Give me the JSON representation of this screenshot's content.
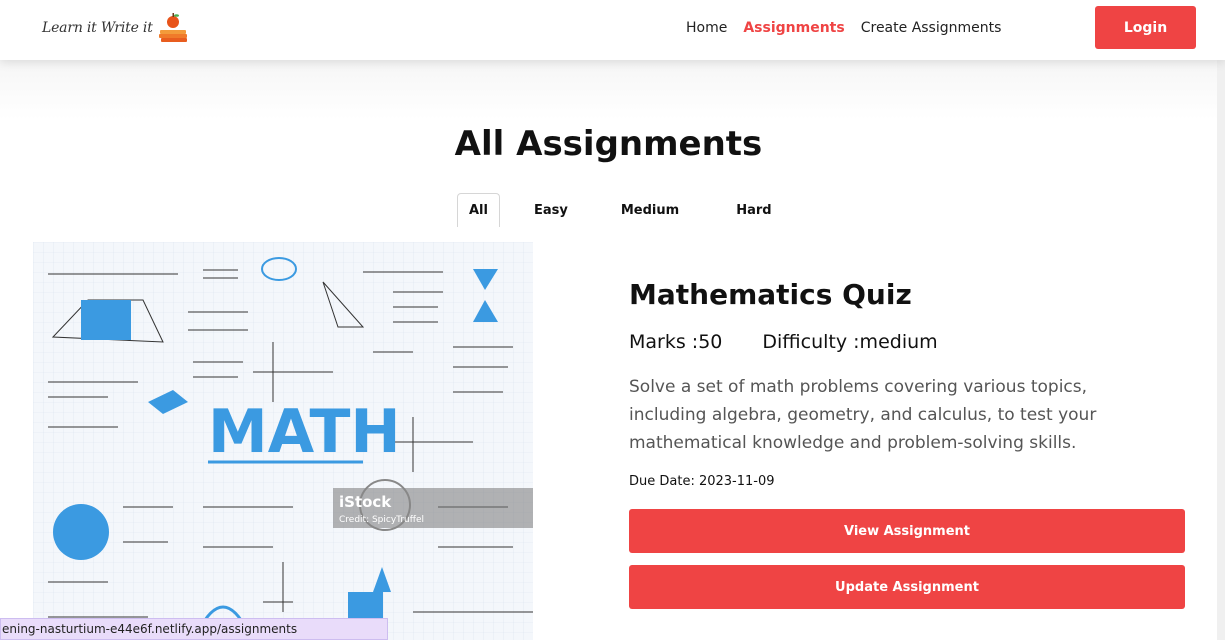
{
  "header": {
    "logo_text": "Learn it Write it",
    "nav": [
      {
        "label": "Home",
        "active": false
      },
      {
        "label": "Assignments",
        "active": true
      },
      {
        "label": "Create Assignments",
        "active": false
      }
    ],
    "login_label": "Login"
  },
  "page": {
    "title": "All Assignments",
    "tabs": [
      {
        "label": "All",
        "active": true
      },
      {
        "label": "Easy",
        "active": false
      },
      {
        "label": "Medium",
        "active": false
      },
      {
        "label": "Hard",
        "active": false
      }
    ]
  },
  "card": {
    "image": {
      "headline": "MATH",
      "watermark": "iStock",
      "credit": "Credit: SpicyTruffel"
    },
    "title": "Mathematics Quiz",
    "marks": "Marks :50",
    "difficulty": "Difficulty :medium",
    "description": "Solve a set of math problems covering various topics, including algebra, geometry, and calculus, to test your mathematical knowledge and problem-solving skills.",
    "due_date": "Due Date: 2023-11-09",
    "view_label": "View Assignment",
    "update_label": "Update Assignment"
  },
  "status_bar": {
    "url": "ening-nasturtium-e44e6f.netlify.app/assignments"
  },
  "colors": {
    "accent": "#ef4444",
    "status_bar_bg": "#e9dcfa"
  }
}
